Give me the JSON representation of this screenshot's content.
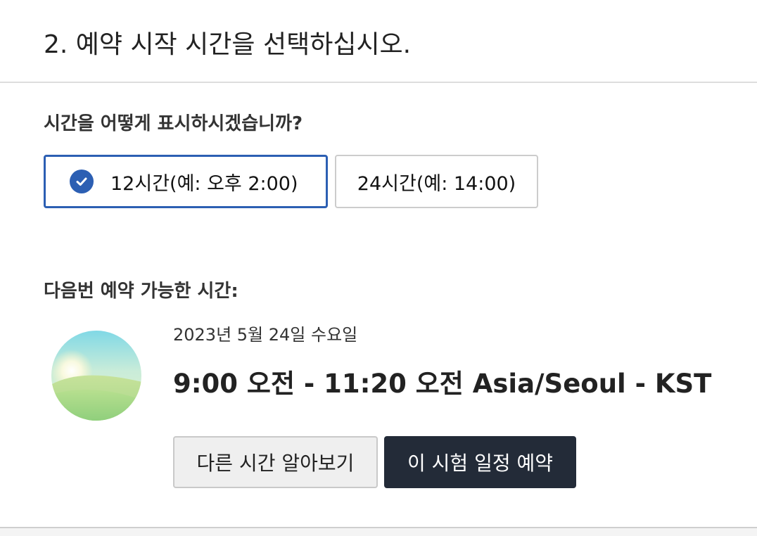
{
  "step": {
    "title": "2. 예약 시작 시간을 선택하십시오."
  },
  "time_format": {
    "question": "시간을 어떻게 표시하시겠습니까?",
    "options": [
      {
        "label": "12시간(예: 오후 2:00)",
        "selected": true
      },
      {
        "label": "24시간(예: 14:00)",
        "selected": false
      }
    ],
    "accent_color": "#2c5fb3"
  },
  "next_available": {
    "heading": "다음번 예약 가능한 시간:",
    "date": "2023년 5월 24일 수요일",
    "time": "9:00 오전 - 11:20 오전 Asia/Seoul - KST",
    "illustration_icon": "morning-sun-landscape-icon"
  },
  "actions": {
    "other_times_label": "다른 시간 알아보기",
    "book_label": "이 시험 일정 예약",
    "book_color": "#232b38"
  }
}
